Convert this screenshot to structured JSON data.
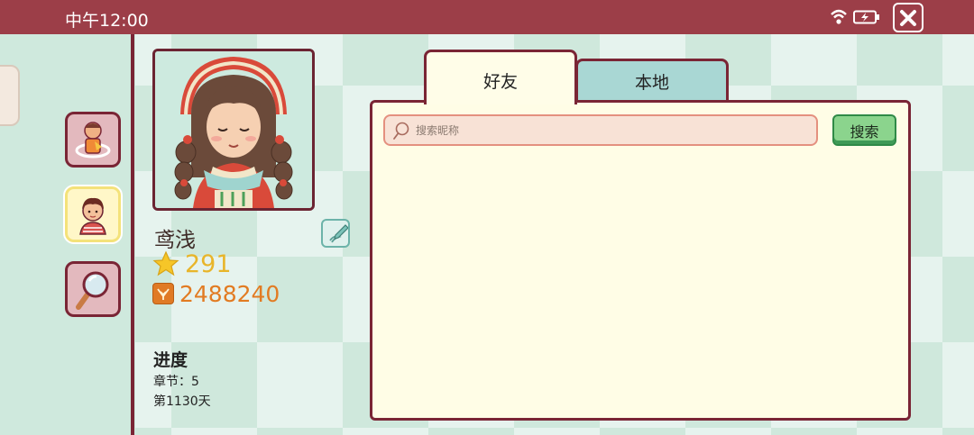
{
  "status_bar": {
    "time": "中午12:00"
  },
  "profile": {
    "name": "鸢浅",
    "stars": "291",
    "coins": "2488240"
  },
  "progress": {
    "title": "进度",
    "chapter": "章节：5",
    "day": "第1130天"
  },
  "tabs": [
    {
      "label": "好友",
      "active": true
    },
    {
      "label": "本地",
      "active": false
    }
  ],
  "search": {
    "placeholder": "搜索昵称",
    "value": "",
    "button_label": "搜索"
  },
  "side_nav": [
    "character-customize",
    "profile",
    "magnifier-search"
  ],
  "colors": {
    "header": "#9c3e48",
    "border": "#7a2535",
    "panel": "#fffde6",
    "star_text": "#e8b52a",
    "coin_text": "#e27b22",
    "search_button": "#8bd48d"
  }
}
